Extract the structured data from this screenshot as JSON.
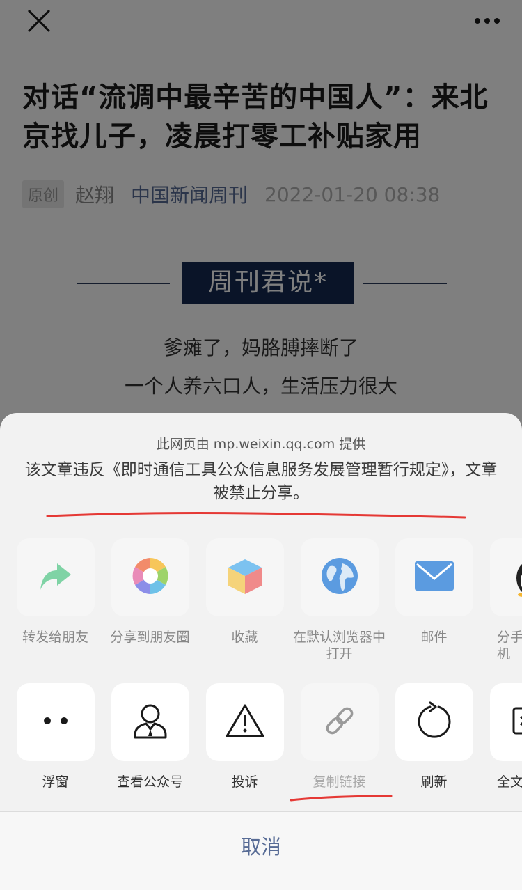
{
  "article": {
    "title": "对话“流调中最辛苦的中国人”：来北京找儿子，凌晨打零工补贴家用",
    "original_tag": "原创",
    "author": "赵翔",
    "account": "中国新闻周刊",
    "date": "2022-01-20 08:38",
    "banner": "周刊君说*",
    "lines": [
      "爹瘫了，妈胳膊摔断了",
      "一个人养六口人，生活压力很大"
    ]
  },
  "sheet": {
    "provider": "此网页由 mp.weixin.qq.com 提供",
    "notice": "该文章违反《即时通信工具公众信息服务发展管理暂行规定》，文章被禁止分享。",
    "row1": [
      {
        "label": "转发给朋友",
        "icon": "share-arrow-icon"
      },
      {
        "label": "分享到朋友圈",
        "icon": "moments-icon"
      },
      {
        "label": "收藏",
        "icon": "favorite-cube-icon"
      },
      {
        "label": "在默认浏览器中打开",
        "icon": "globe-icon"
      },
      {
        "label": "邮件",
        "icon": "mail-icon"
      },
      {
        "label": "分手机",
        "icon": "qq-penguin-icon"
      }
    ],
    "row2": [
      {
        "label": "浮窗",
        "icon": "float-window-icon"
      },
      {
        "label": "查看公众号",
        "icon": "person-icon"
      },
      {
        "label": "投诉",
        "icon": "warning-icon"
      },
      {
        "label": "复制链接",
        "icon": "link-icon"
      },
      {
        "label": "刷新",
        "icon": "refresh-icon"
      },
      {
        "label": "全文",
        "icon": "fulltext-icon"
      }
    ],
    "cancel": "取消"
  },
  "colors": {
    "link_blue": "#576b95",
    "annotation_red": "#e53935",
    "banner_navy": "#142850"
  }
}
